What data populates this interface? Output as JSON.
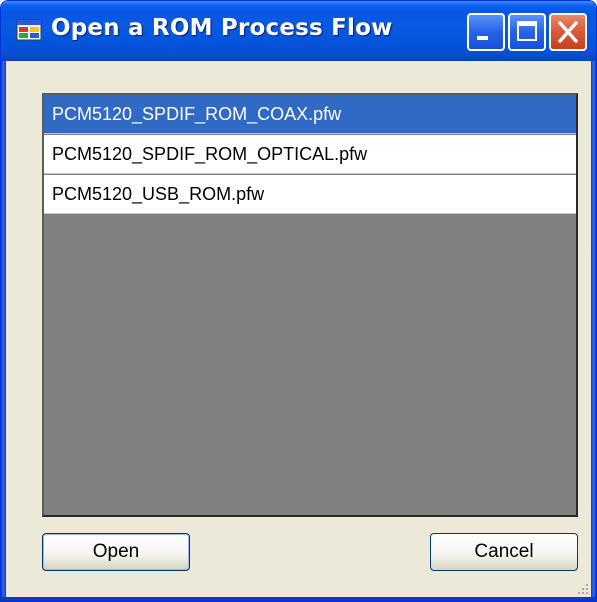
{
  "window": {
    "title": "Open a ROM Process Flow",
    "title_icon": "app-window-icon",
    "controls": {
      "minimize": "minimize-icon",
      "maximize": "maximize-icon",
      "close": "close-icon"
    }
  },
  "file_list": {
    "items": [
      {
        "label": "PCM5120_SPDIF_ROM_COAX.pfw",
        "selected": true
      },
      {
        "label": "PCM5120_SPDIF_ROM_OPTICAL.pfw",
        "selected": false
      },
      {
        "label": "PCM5120_USB_ROM.pfw",
        "selected": false
      }
    ]
  },
  "buttons": {
    "open_label": "Open",
    "cancel_label": "Cancel"
  },
  "colors": {
    "titlebar": "#0a5ae0",
    "selection": "#316ac5",
    "dialog_background": "#ece9d8",
    "list_empty_area": "#808080",
    "close_button": "#dc5a3a"
  }
}
